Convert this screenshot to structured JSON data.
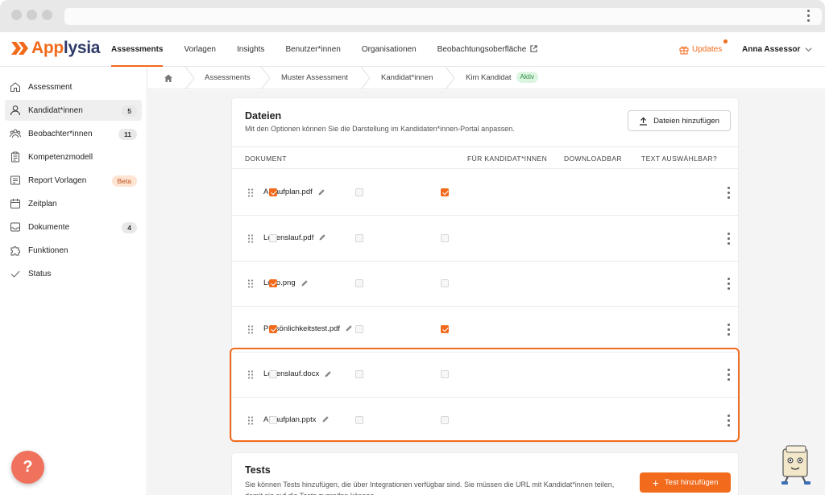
{
  "brand": {
    "name_part1": "App",
    "name_part2": "lysia",
    "accent": "#f26a1b",
    "navy": "#2f3a68"
  },
  "nav": {
    "items": [
      {
        "label": "Assessments",
        "active": true
      },
      {
        "label": "Vorlagen"
      },
      {
        "label": "Insights"
      },
      {
        "label": "Benutzer*innen"
      },
      {
        "label": "Organisationen"
      },
      {
        "label": "Beobachtungsoberfläche",
        "icon": "external-link-icon"
      }
    ],
    "updates_label": "Updates",
    "user_name": "Anna Assessor"
  },
  "sidebar": {
    "items": [
      {
        "label": "Assessment",
        "icon": "home-icon"
      },
      {
        "label": "Kandidat*innen",
        "icon": "candidate-icon",
        "badge": "5",
        "active": true
      },
      {
        "label": "Beobachter*innen",
        "icon": "group-icon",
        "badge": "11"
      },
      {
        "label": "Kompetenzmodell",
        "icon": "clipboard-icon"
      },
      {
        "label": "Report Vorlagen",
        "icon": "report-icon",
        "badge": "Beta"
      },
      {
        "label": "Zeitplan",
        "icon": "calendar-icon"
      },
      {
        "label": "Dokumente",
        "icon": "inbox-icon",
        "badge": "4"
      },
      {
        "label": "Funktionen",
        "icon": "puzzle-icon"
      },
      {
        "label": "Status",
        "icon": "check-icon"
      }
    ]
  },
  "breadcrumb": {
    "items": [
      "Assessments",
      "Muster Assessment",
      "Kandidat*innen",
      "Kim Kandidat"
    ],
    "status_badge": "Aktiv"
  },
  "files_card": {
    "title": "Dateien",
    "subtitle": "Mit den Optionen können Sie die Darstellung im Kandidaten*innen-Portal anpassen.",
    "add_button": "Dateien hinzufügen",
    "columns": [
      "DOKUMENT",
      "FÜR KANDIDAT*INNEN",
      "DOWNLOADBAR",
      "TEXT AUSWÄHLBAR?"
    ],
    "rows": [
      {
        "name": "Ablaufplan.pdf",
        "for_candidates": true,
        "downloadable": false,
        "text_selectable": true
      },
      {
        "name": "Lebenslauf.pdf",
        "for_candidates": false,
        "downloadable": false,
        "text_selectable": false
      },
      {
        "name": "Logo.png",
        "for_candidates": true,
        "downloadable": false,
        "text_selectable": false
      },
      {
        "name": "Persönlichkeitstest.pdf",
        "for_candidates": true,
        "downloadable": false,
        "text_selectable": true
      },
      {
        "name": "Lebenslauf.docx",
        "for_candidates": false,
        "downloadable": false,
        "text_selectable": false
      },
      {
        "name": "Ablaufplan.pptx",
        "for_candidates": false,
        "downloadable": false,
        "text_selectable": false
      }
    ]
  },
  "tests_card": {
    "title": "Tests",
    "subtitle": "Sie können Tests hinzufügen, die über Integrationen verfügbar sind. Sie müssen die URL mit Kandidat*innen teilen, damit sie auf die Tests zugreifen können.",
    "add_button": "Test hinzufügen"
  },
  "help_label": "?"
}
